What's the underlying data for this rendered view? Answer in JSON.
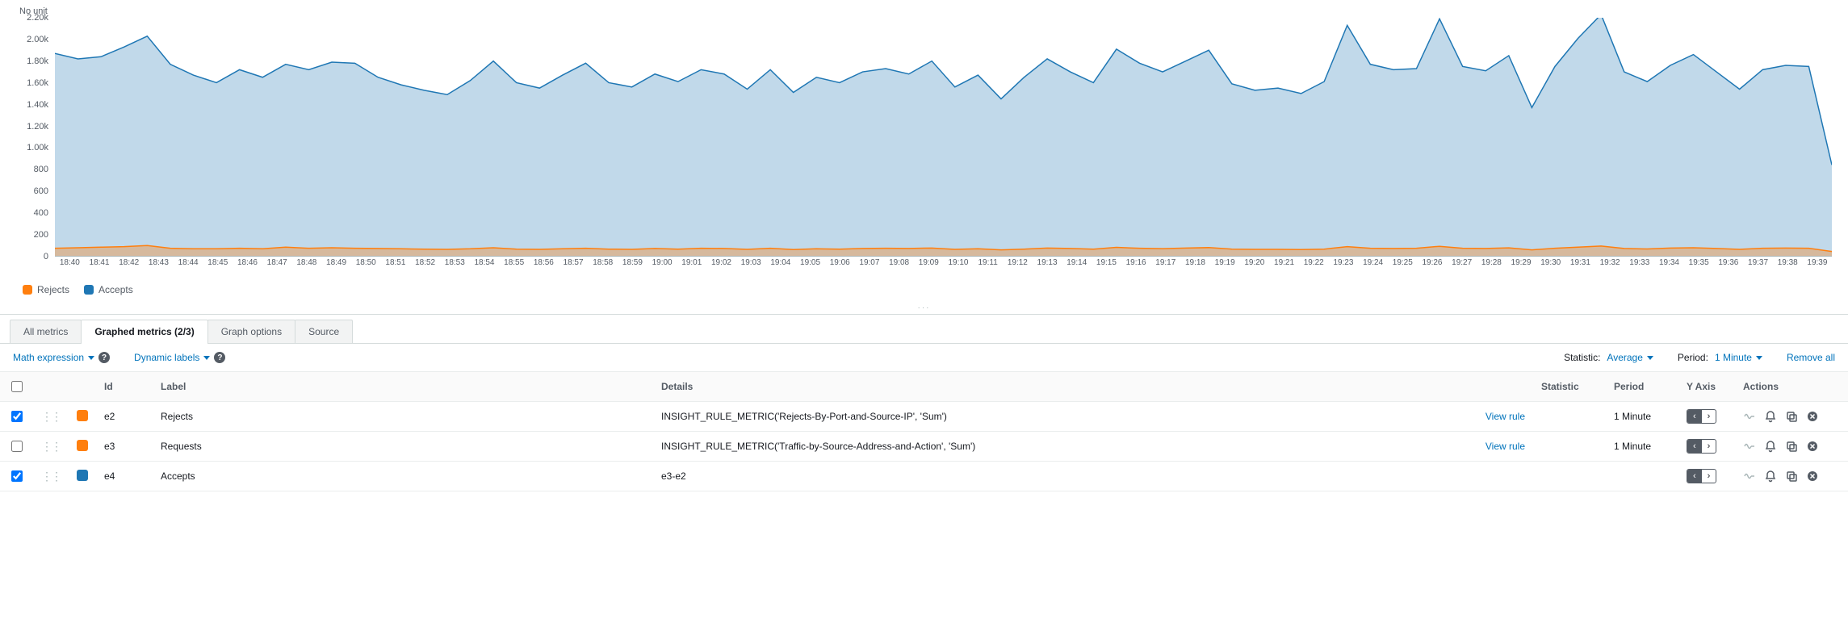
{
  "chart_unit_label": "No unit",
  "y_ticks": [
    "0",
    "200",
    "400",
    "600",
    "800",
    "1.00k",
    "1.20k",
    "1.40k",
    "1.60k",
    "1.80k",
    "2.00k",
    "2.20k"
  ],
  "x_ticks": [
    "18:40",
    "18:41",
    "18:42",
    "18:43",
    "18:44",
    "18:45",
    "18:46",
    "18:47",
    "18:48",
    "18:49",
    "18:50",
    "18:51",
    "18:52",
    "18:53",
    "18:54",
    "18:55",
    "18:56",
    "18:57",
    "18:58",
    "18:59",
    "19:00",
    "19:01",
    "19:02",
    "19:03",
    "19:04",
    "19:05",
    "19:06",
    "19:07",
    "19:08",
    "19:09",
    "19:10",
    "19:11",
    "19:12",
    "19:13",
    "19:14",
    "19:15",
    "19:16",
    "19:17",
    "19:18",
    "19:19",
    "19:20",
    "19:21",
    "19:22",
    "19:23",
    "19:24",
    "19:25",
    "19:26",
    "19:27",
    "19:28",
    "19:29",
    "19:30",
    "19:31",
    "19:32",
    "19:33",
    "19:34",
    "19:35",
    "19:36",
    "19:37",
    "19:38",
    "19:39"
  ],
  "legend": [
    {
      "label": "Rejects",
      "color": "#ff7f0e"
    },
    {
      "label": "Accepts",
      "color": "#1f77b4"
    }
  ],
  "tabs": {
    "all_metrics": "All metrics",
    "graphed_metrics": "Graphed metrics (2/3)",
    "graph_options": "Graph options",
    "source": "Source"
  },
  "toolbar": {
    "math_expression": "Math expression",
    "dynamic_labels": "Dynamic labels",
    "statistic_label": "Statistic:",
    "statistic_value": "Average",
    "period_label": "Period:",
    "period_value": "1 Minute",
    "remove_all": "Remove all"
  },
  "table": {
    "headers": {
      "id": "Id",
      "label": "Label",
      "details": "Details",
      "statistic": "Statistic",
      "period": "Period",
      "yaxis": "Y Axis",
      "actions": "Actions"
    },
    "rows": [
      {
        "checked": true,
        "color": "#ff7f0e",
        "id": "e2",
        "label": "Rejects",
        "details": "INSIGHT_RULE_METRIC('Rejects-By-Port-and-Source-IP', 'Sum')",
        "view_rule": "View rule",
        "statistic": "",
        "period": "1 Minute",
        "yaxis_side": "left"
      },
      {
        "checked": false,
        "color": "#ff7f0e",
        "id": "e3",
        "label": "Requests",
        "details": "INSIGHT_RULE_METRIC('Traffic-by-Source-Address-and-Action', 'Sum')",
        "view_rule": "View rule",
        "statistic": "",
        "period": "1 Minute",
        "yaxis_side": "left"
      },
      {
        "checked": true,
        "color": "#1f77b4",
        "id": "e4",
        "label": "Accepts",
        "details": "e3-e2",
        "view_rule": "",
        "statistic": "",
        "period": "",
        "yaxis_side": "left"
      }
    ],
    "yaxis_left_glyph": "‹",
    "yaxis_right_glyph": "›"
  },
  "chart_data": {
    "type": "area",
    "title": "",
    "xlabel": "",
    "ylabel": "No unit",
    "ylim": [
      0,
      2200
    ],
    "x": [
      "18:40",
      "18:41",
      "18:42",
      "18:43",
      "18:44",
      "18:45",
      "18:46",
      "18:47",
      "18:48",
      "18:49",
      "18:50",
      "18:51",
      "18:52",
      "18:53",
      "18:54",
      "18:55",
      "18:56",
      "18:57",
      "18:58",
      "18:59",
      "19:00",
      "19:01",
      "19:02",
      "19:03",
      "19:04",
      "19:05",
      "19:06",
      "19:07",
      "19:08",
      "19:09",
      "19:10",
      "19:11",
      "19:12",
      "19:13",
      "19:14",
      "19:15",
      "19:16",
      "19:17",
      "19:18",
      "19:19",
      "19:20",
      "19:21",
      "19:22",
      "19:23",
      "19:24",
      "19:25",
      "19:26",
      "19:27",
      "19:28",
      "19:29",
      "19:30",
      "19:31",
      "19:32",
      "19:33",
      "19:34",
      "19:35",
      "19:36",
      "19:37",
      "19:38",
      "19:39"
    ],
    "series": [
      {
        "name": "Accepts",
        "color": "#1f77b4",
        "values": [
          1870,
          1820,
          1840,
          1930,
          2030,
          1770,
          1670,
          1600,
          1720,
          1650,
          1770,
          1720,
          1790,
          1780,
          1650,
          1580,
          1530,
          1490,
          1620,
          1800,
          1600,
          1550,
          1670,
          1780,
          1600,
          1560,
          1680,
          1610,
          1720,
          1680,
          1540,
          1720,
          1510,
          1650,
          1600,
          1700,
          1730,
          1680,
          1800,
          1560,
          1670,
          1450,
          1650,
          1820,
          1700,
          1600,
          1910,
          1780,
          1700,
          1800,
          1900,
          1590,
          1530,
          1550,
          1500,
          1610,
          2130,
          1770,
          1720,
          1730,
          2190,
          1750,
          1710,
          1850,
          1370,
          1750,
          2010,
          2230,
          1700,
          1610,
          1760,
          1860,
          1700,
          1540,
          1720,
          1760,
          1750,
          840
        ]
      },
      {
        "name": "Rejects",
        "color": "#ff7f0e",
        "values": [
          70,
          75,
          80,
          85,
          95,
          70,
          65,
          65,
          70,
          65,
          80,
          70,
          75,
          70,
          68,
          65,
          62,
          60,
          65,
          75,
          62,
          60,
          65,
          70,
          62,
          60,
          68,
          62,
          70,
          68,
          60,
          70,
          58,
          65,
          62,
          68,
          70,
          68,
          72,
          60,
          65,
          55,
          62,
          72,
          68,
          62,
          78,
          70,
          66,
          72,
          76,
          62,
          60,
          60,
          58,
          62,
          85,
          70,
          68,
          70,
          88,
          70,
          68,
          74,
          55,
          70,
          80,
          90,
          68,
          63,
          72,
          75,
          68,
          60,
          70,
          72,
          70,
          40
        ]
      }
    ]
  }
}
